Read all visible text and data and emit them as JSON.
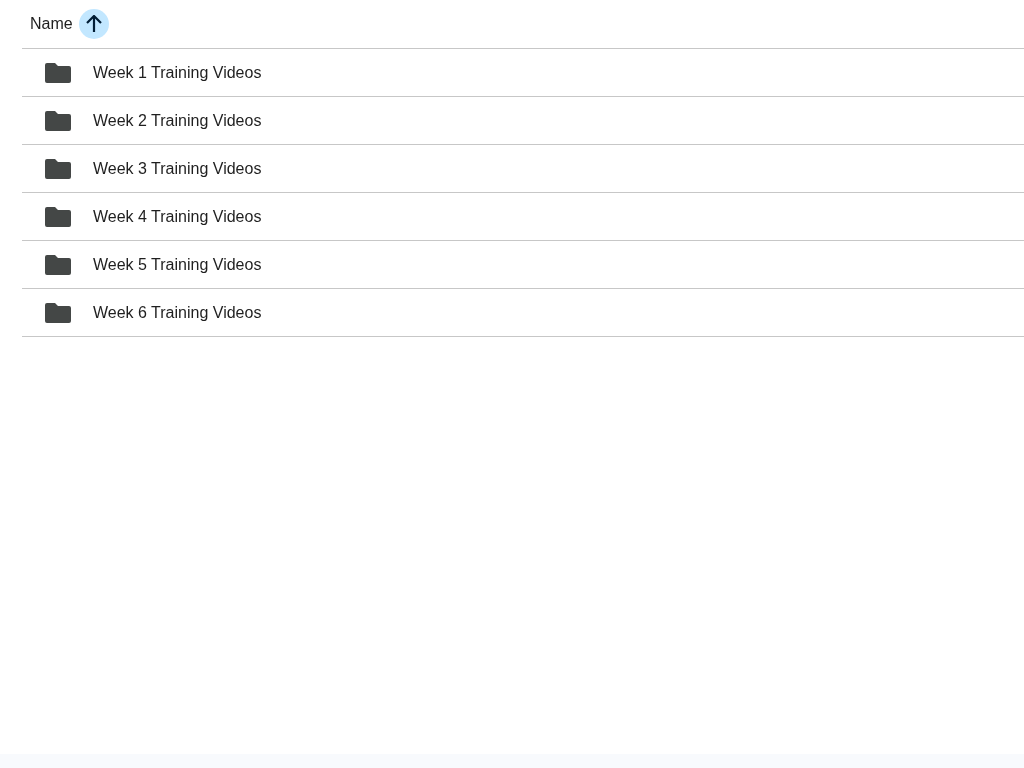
{
  "header": {
    "label": "Name",
    "sort_ascending": true
  },
  "rows": [
    {
      "name": "Week 1 Training Videos"
    },
    {
      "name": "Week 2 Training Videos"
    },
    {
      "name": "Week 3 Training Videos"
    },
    {
      "name": "Week 4 Training Videos"
    },
    {
      "name": "Week 5 Training Videos"
    },
    {
      "name": "Week 6 Training Videos"
    }
  ]
}
